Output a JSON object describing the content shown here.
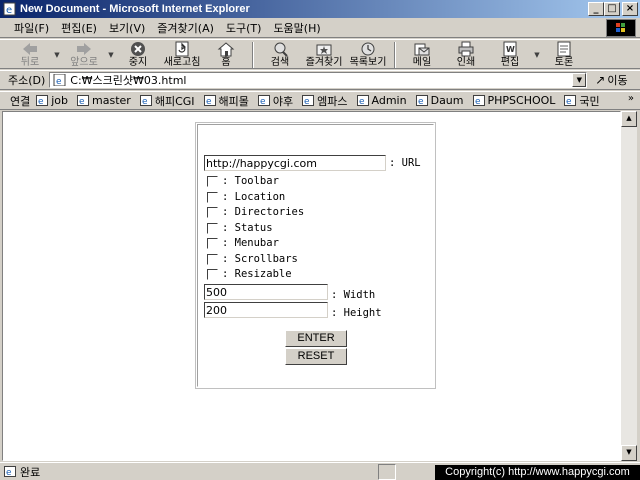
{
  "window": {
    "title": "New Document - Microsoft Internet Explorer",
    "minimize_glyph": "_",
    "maximize_glyph": "□",
    "close_glyph": "×"
  },
  "menu": [
    "파일(F)",
    "편집(E)",
    "보기(V)",
    "즐겨찾기(A)",
    "도구(T)",
    "도움말(H)"
  ],
  "toolbar": {
    "back": "뒤로",
    "forward": "앞으로",
    "stop": "중지",
    "refresh": "새로고침",
    "home": "홈",
    "search": "검색",
    "favorites": "즐겨찾기",
    "history": "목록보기",
    "mail": "메일",
    "print": "인쇄",
    "edit": "편집",
    "discuss": "토론"
  },
  "address": {
    "label": "주소(D)",
    "value": "C:₩스크린샷₩03.html",
    "go": "이동"
  },
  "links": {
    "label": "연결",
    "items": [
      "job",
      "master",
      "해피CGI",
      "해피몰",
      "야후",
      "엠파스",
      "Admin",
      "Daum",
      "PHPSCHOOL",
      "국민"
    ],
    "more": "»"
  },
  "form": {
    "url_value": "http://happycgi.com",
    "url_label": ": URL",
    "options": [
      ": Toolbar",
      ": Location",
      ": Directories",
      ": Status",
      ": Menubar",
      ": Scrollbars",
      ": Resizable"
    ],
    "width_value": "500",
    "width_label": ": Width",
    "height_value": "200",
    "height_label": ": Height",
    "enter": "ENTER",
    "reset": "RESET"
  },
  "status": {
    "text": "완료",
    "copyright": "Copyright(c) http://www.happycgi.com"
  },
  "colors": {
    "titlebar_start": "#0a246a",
    "titlebar_end": "#a6caf0",
    "chrome": "#d4d0c8"
  }
}
